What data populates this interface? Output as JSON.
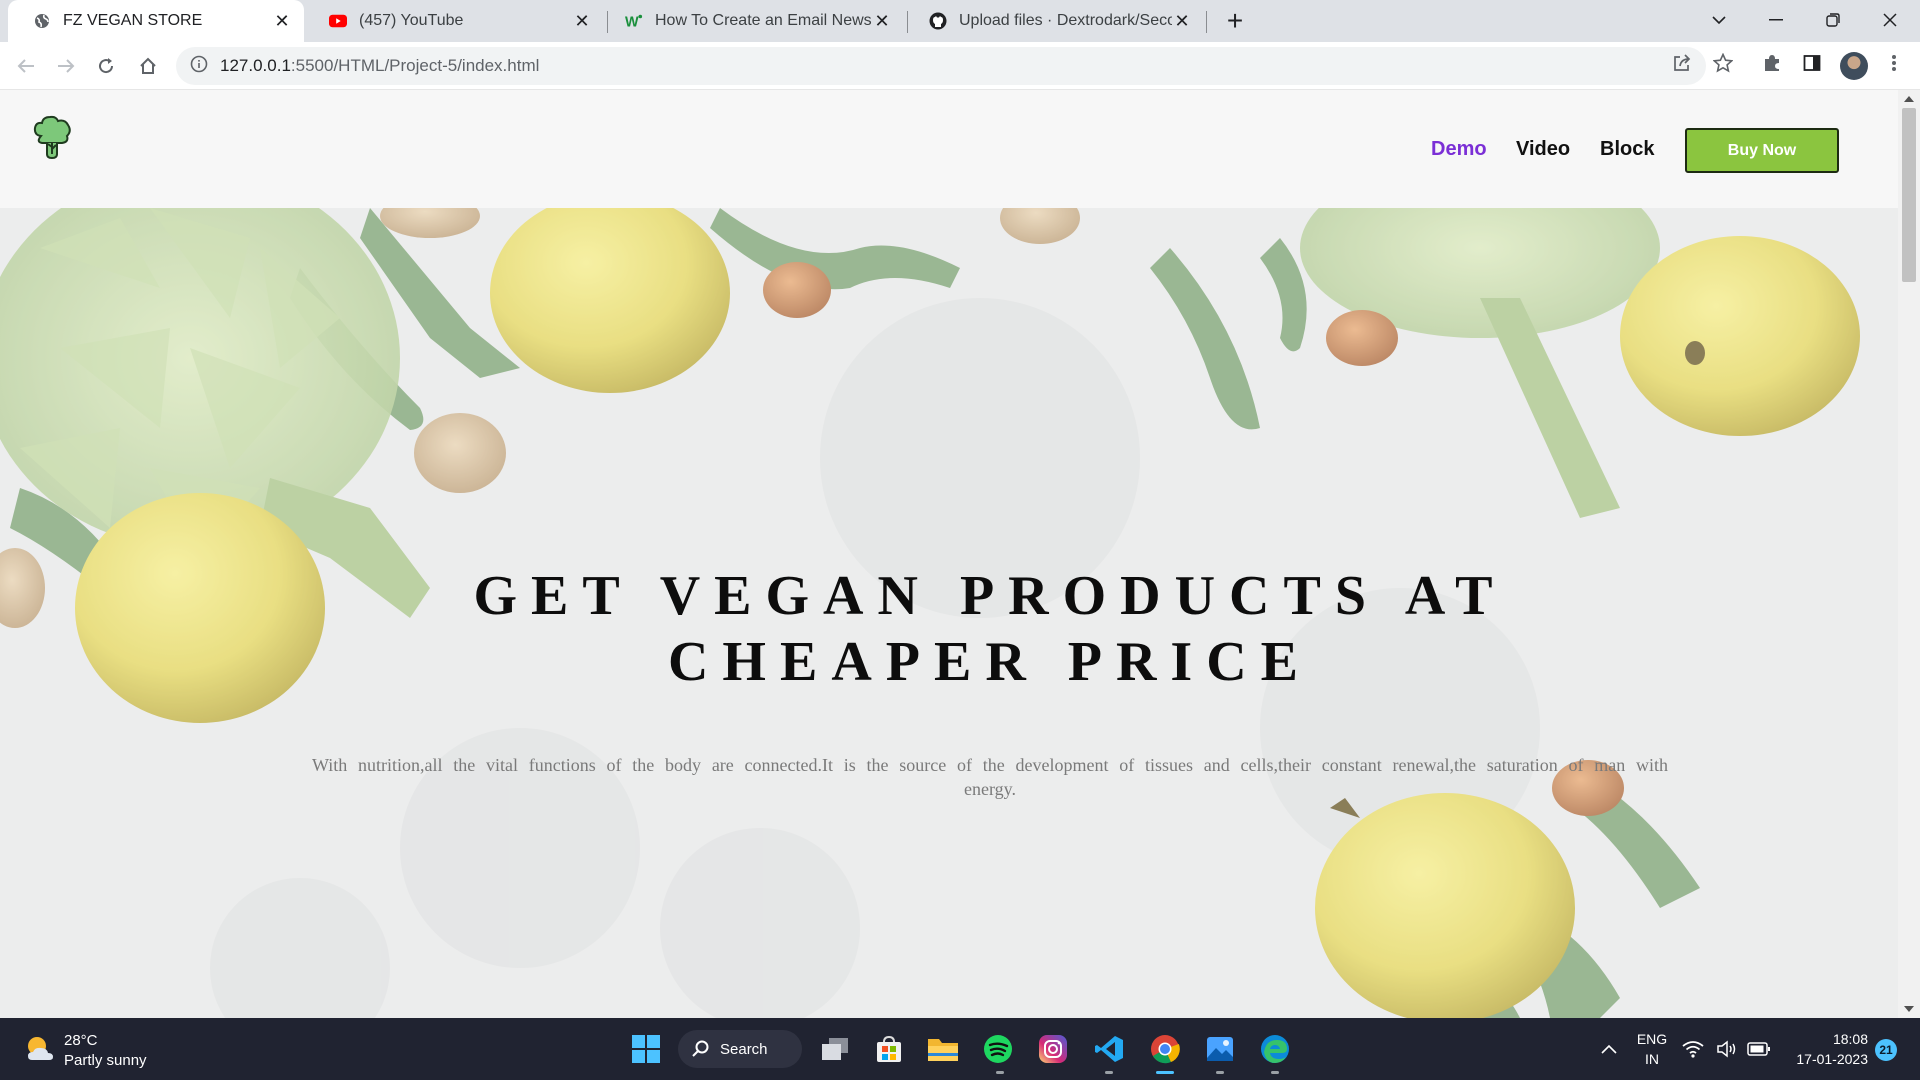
{
  "browser": {
    "tabs": [
      {
        "title": "FZ VEGAN STORE",
        "active": true,
        "icon": "globe-icon"
      },
      {
        "title": "(457) YouTube",
        "active": false,
        "icon": "youtube-icon"
      },
      {
        "title": "How To Create an Email Newslett",
        "active": false,
        "icon": "w-icon"
      },
      {
        "title": "Upload files · Dextrodark/Second",
        "active": false,
        "icon": "github-icon"
      }
    ],
    "url_host": "127.0.0.1",
    "url_path": ":5500/HTML/Project-5/index.html"
  },
  "site": {
    "nav": [
      {
        "label": "Demo",
        "active": true
      },
      {
        "label": "Video",
        "active": false
      },
      {
        "label": "Block",
        "active": false
      }
    ],
    "buy_button": "Buy Now",
    "hero_title": "GET VEGAN PRODUCTS AT CHEAPER PRICE",
    "hero_text": "With nutrition,all the vital functions of the body are connected.It is the source of the development of tissues and cells,their constant renewal,the saturation of man with energy.",
    "colors": {
      "accent": "#7b2fd6",
      "button": "#8bc53f"
    }
  },
  "taskbar": {
    "temperature": "28°C",
    "weather": "Partly sunny",
    "search_label": "Search",
    "language_1": "ENG",
    "language_2": "IN",
    "time": "18:08",
    "date": "17-01-2023",
    "notifications": "21"
  }
}
